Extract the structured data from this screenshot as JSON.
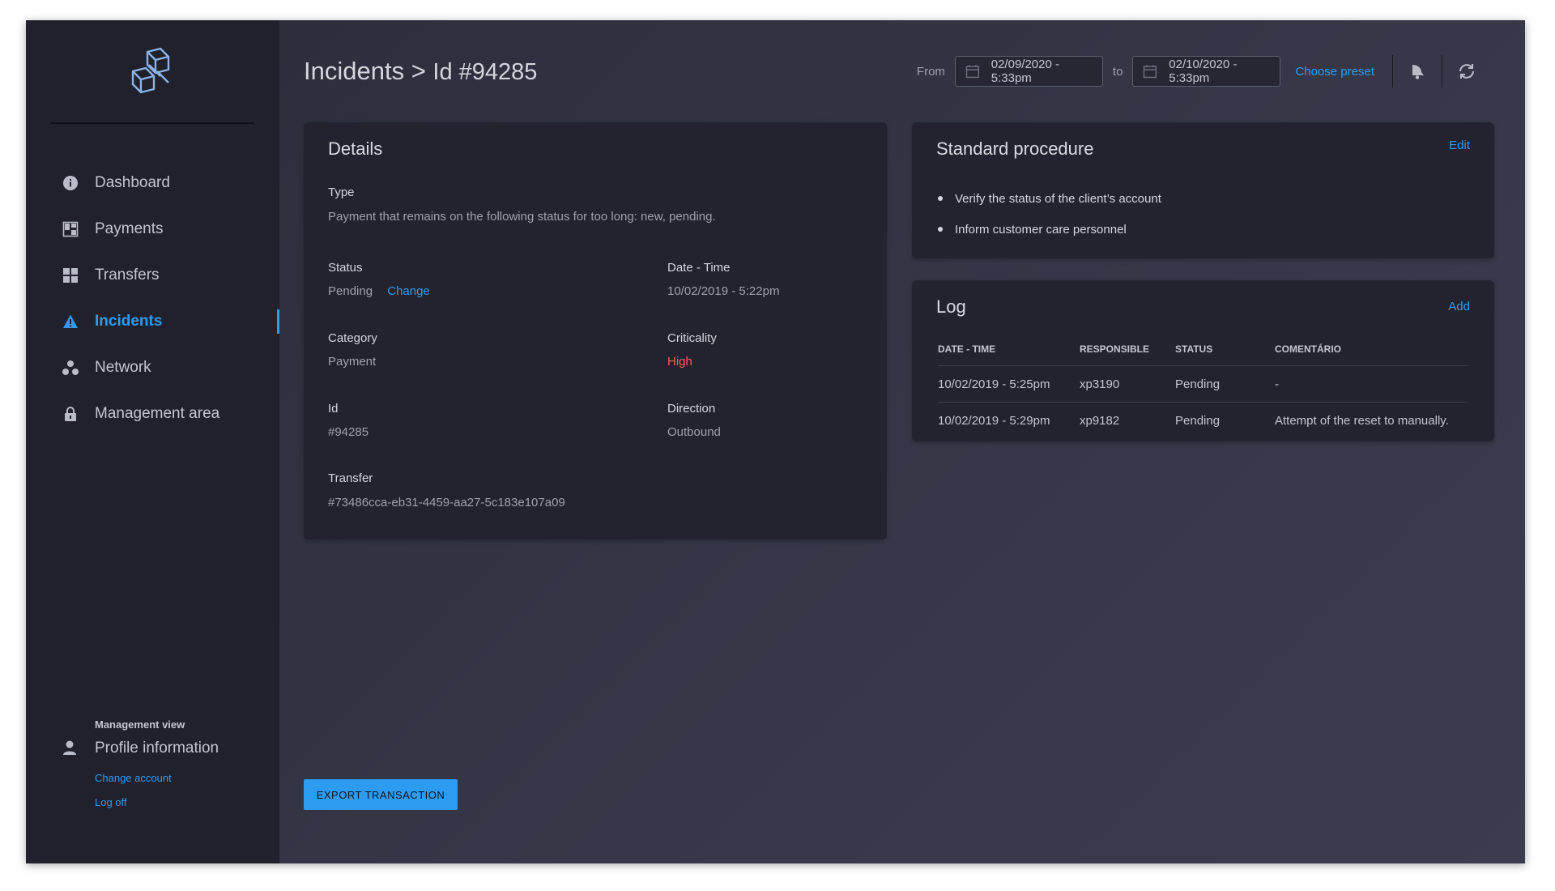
{
  "sidebar": {
    "logo_icon": "cube-stack-icon",
    "items": [
      {
        "label": "Dashboard",
        "icon": "info-circle-icon"
      },
      {
        "label": "Payments",
        "icon": "payments-icon"
      },
      {
        "label": "Transfers",
        "icon": "grid-icon"
      },
      {
        "label": "Incidents",
        "icon": "warning-triangle-icon",
        "active": true
      },
      {
        "label": "Network",
        "icon": "network-icon"
      },
      {
        "label": "Management area",
        "icon": "lock-icon"
      }
    ],
    "profile": {
      "section_label": "Management view",
      "title": "Profile information",
      "change_account": "Change account",
      "log_off": "Log off"
    }
  },
  "header": {
    "title": "Incidents >",
    "id": "Id #94285",
    "from_label": "From",
    "from_value": "02/09/2020 - 5:33pm",
    "to_label": "to",
    "to_value": "02/10/2020 - 5:33pm",
    "choose_preset": "Choose preset"
  },
  "details": {
    "title": "Details",
    "type_label": "Type",
    "type_value": "Payment that remains on the following status for too long: new, pending.",
    "status_label": "Status",
    "status_value": "Pending",
    "status_change": "Change",
    "datetime_label": "Date - Time",
    "datetime_value": "10/02/2019 - 5:22pm",
    "category_label": "Category",
    "category_value": "Payment",
    "criticality_label": "Criticality",
    "criticality_value": "High",
    "id_label": "Id",
    "id_value": "#94285",
    "direction_label": "Direction",
    "direction_value": "Outbound",
    "transfer_label": "Transfer",
    "transfer_value": "#73486cca-eb31-4459-aa27-5c183e107a09"
  },
  "procedure": {
    "title": "Standard procedure",
    "edit": "Edit",
    "steps": [
      "Verify the status of the client’s account",
      "Inform customer care personnel"
    ]
  },
  "log": {
    "title": "Log",
    "add": "Add",
    "columns": [
      "DATE - TIME",
      "RESPONSIBLE",
      "STATUS",
      "COMENTÁRIO"
    ],
    "rows": [
      [
        "10/02/2019 - 5:25pm",
        "xp3190",
        "Pending",
        "-"
      ],
      [
        "10/02/2019 - 5:29pm",
        "xp9182",
        "Pending",
        "Attempt of the reset to manually."
      ]
    ]
  },
  "export_button": "EXPORT TRANSACTION",
  "colors": {
    "accent": "#2d9cf0",
    "sidebar": "#20212c",
    "danger": "#ff5a5a"
  }
}
